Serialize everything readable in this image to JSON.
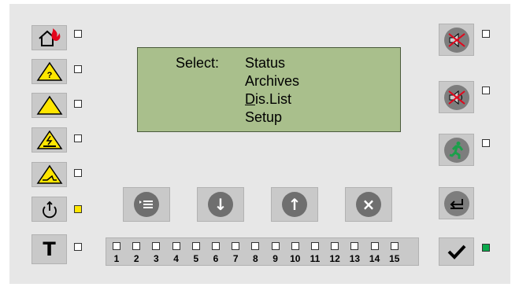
{
  "display": {
    "select_label": "Select:",
    "menu_items": [
      "Status",
      "Archives",
      "Dis.List",
      "Setup"
    ],
    "selected_item_underlined_char": "D"
  },
  "left_buttons": [
    {
      "name": "fire-alarm-button",
      "icon": "house-fire-icon",
      "indicator": "off"
    },
    {
      "name": "fault-warning-button",
      "icon": "warning-question-icon",
      "indicator": "off"
    },
    {
      "name": "general-warning-button",
      "icon": "warning-triangle-icon",
      "indicator": "off"
    },
    {
      "name": "power-fault-button",
      "icon": "warning-power-icon",
      "indicator": "off"
    },
    {
      "name": "disablement-button",
      "icon": "warning-disable-icon",
      "indicator": "off"
    },
    {
      "name": "power-button",
      "icon": "power-icon",
      "indicator": "on"
    },
    {
      "name": "test-button",
      "icon": "test-t-icon",
      "text": "T",
      "indicator": "off"
    }
  ],
  "right_buttons": [
    {
      "name": "silence-buzzer-button",
      "icon": "buzzer-muted-icon",
      "indicator": "off"
    },
    {
      "name": "silence-sounders-button",
      "icon": "sounder-muted-icon",
      "indicator": "off"
    },
    {
      "name": "evacuate-button",
      "icon": "running-man-icon",
      "indicator": "off"
    },
    {
      "name": "back-button",
      "icon": "return-arrow-icon"
    },
    {
      "name": "confirm-button",
      "icon": "checkmark-icon",
      "indicator": "on"
    }
  ],
  "nav_buttons": [
    {
      "name": "menu-button",
      "icon": "menu-list-icon"
    },
    {
      "name": "down-button",
      "icon": "arrow-down-icon",
      "glyph": "↓"
    },
    {
      "name": "up-button",
      "icon": "arrow-up-icon",
      "glyph": "↑"
    },
    {
      "name": "cancel-button",
      "icon": "close-icon",
      "glyph": "×"
    }
  ],
  "zones": [
    "1",
    "2",
    "3",
    "4",
    "5",
    "6",
    "7",
    "8",
    "9",
    "10",
    "11",
    "12",
    "13",
    "14",
    "15"
  ],
  "colors": {
    "panel": "#e7e7e7",
    "lcd": "#a9bf8c",
    "indicator_yellow": "#ffe600",
    "indicator_green": "#0aa84b",
    "warning_yellow": "#ffe600",
    "fire_red": "#e3051b",
    "runner_green": "#1aa04a"
  }
}
